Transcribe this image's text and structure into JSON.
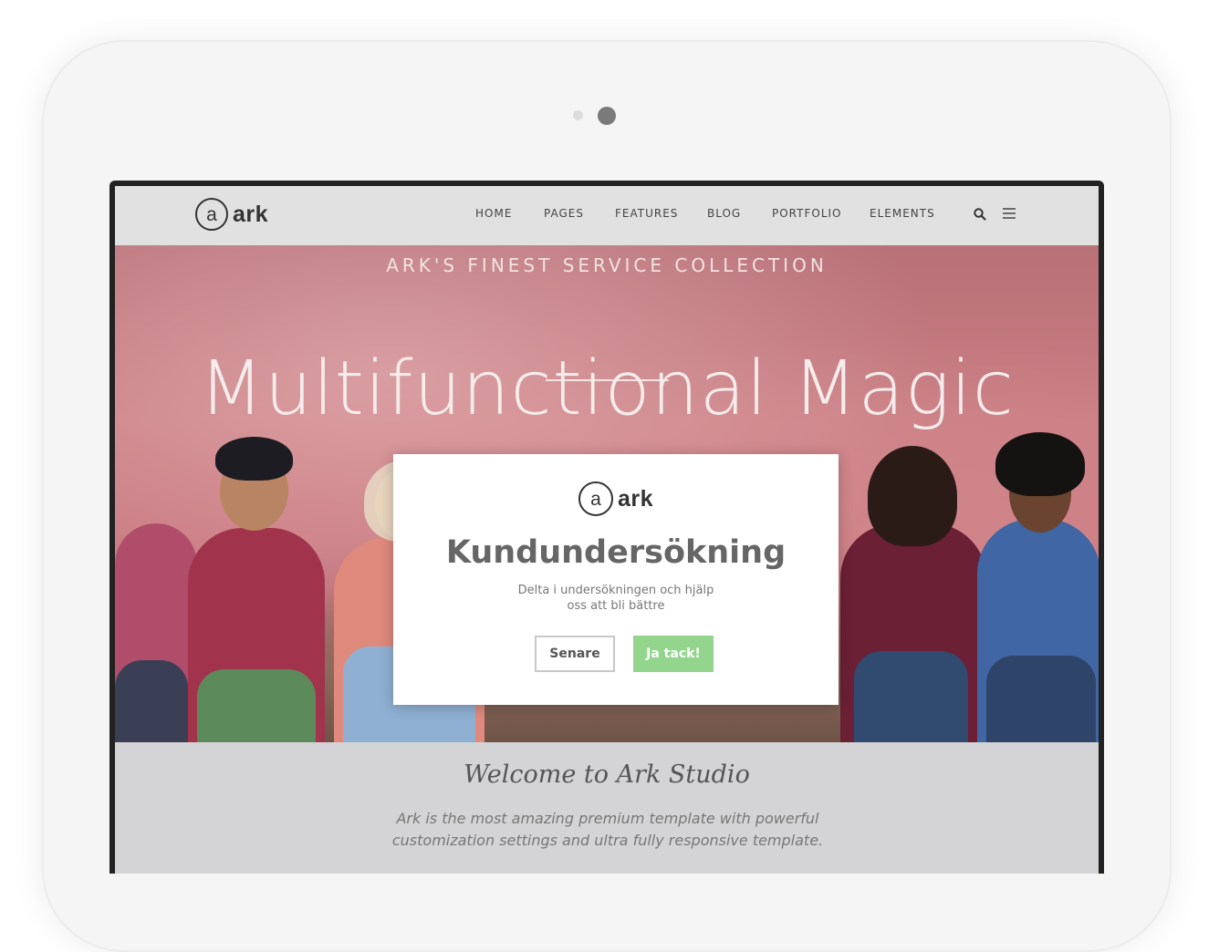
{
  "nav": {
    "logo_letter": "a",
    "logo_text": "ark",
    "items": [
      "HOME",
      "PAGES",
      "FEATURES",
      "BLOG",
      "PORTFOLIO",
      "ELEMENTS"
    ],
    "icons": [
      "search-icon",
      "hamburger-icon"
    ]
  },
  "hero": {
    "kicker": "ARK'S FINEST SERVICE COLLECTION",
    "title": "Multifunctional Magic"
  },
  "modal": {
    "logo_letter": "a",
    "logo_text": "ark",
    "title": "Kundundersökning",
    "text": "Delta i undersökningen och hjälp oss att bli bättre",
    "later_label": "Senare",
    "yes_label": "Ja tack!",
    "yes_color": "#94d58e"
  },
  "welcome": {
    "title": "Welcome to Ark Studio",
    "text": "Ark is the most amazing premium template with powerful customization settings and ultra fully responsive template."
  }
}
